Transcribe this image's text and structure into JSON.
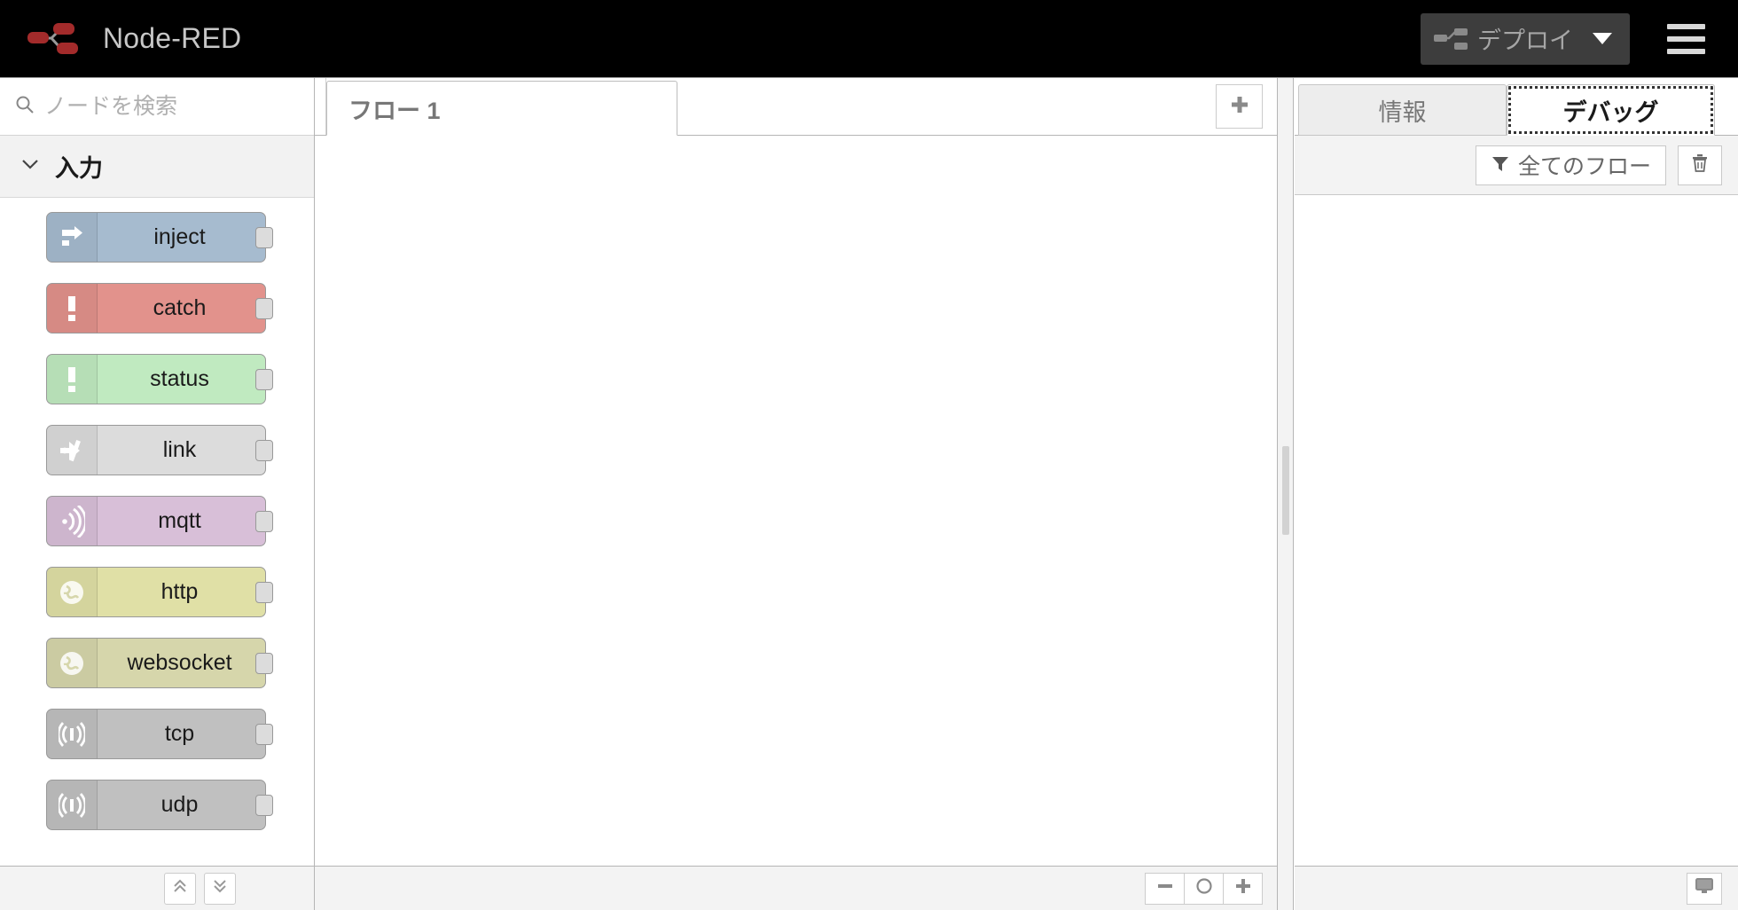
{
  "header": {
    "brand_title": "Node-RED",
    "brand_logo_icon": "node-red-logo-icon",
    "deploy": {
      "label": "デプロイ",
      "icon": "deploy-node-icon",
      "caret_icon": "chevron-down-icon",
      "disabled": true,
      "background": "#3d3d3d",
      "text_color": "#a6a6a6"
    },
    "menu_icon": "hamburger-menu-icon",
    "background": "#000000"
  },
  "palette": {
    "search": {
      "placeholder": "ノードを検索",
      "value": "",
      "icon": "search-icon"
    },
    "categories": [
      {
        "label": "入力",
        "chevron_icon": "chevron-down-icon",
        "expanded": true,
        "nodes": [
          {
            "label": "inject",
            "icon": "inject-arrow-icon",
            "color": "#a6bbcf"
          },
          {
            "label": "catch",
            "icon": "exclamation-icon",
            "color": "#e2928c"
          },
          {
            "label": "status",
            "icon": "exclamation-icon",
            "color": "#c0eac0"
          },
          {
            "label": "link",
            "icon": "link-arrow-icon",
            "color": "#dcdcdc"
          },
          {
            "label": "mqtt",
            "icon": "signal-wave-icon",
            "color": "#d8bfd8"
          },
          {
            "label": "http",
            "icon": "globe-icon",
            "color": "#e0e0a6"
          },
          {
            "label": "websocket",
            "icon": "globe-icon",
            "color": "#d6d6ab"
          },
          {
            "label": "tcp",
            "icon": "bidirectional-signal-icon",
            "color": "#c0c0c0"
          },
          {
            "label": "udp",
            "icon": "bidirectional-signal-icon",
            "color": "#c0c0c0"
          }
        ]
      }
    ],
    "footer": {
      "collapse_all_label": "collapse-all",
      "collapse_all_icon": "double-chevron-up-icon",
      "expand_all_label": "expand-all",
      "expand_all_icon": "double-chevron-down-icon"
    }
  },
  "workspace": {
    "tabs": [
      {
        "label": "フロー 1",
        "active": true
      }
    ],
    "add_tab_icon": "plus-icon",
    "canvas_empty": true,
    "zoom_controls": {
      "zoom_out_icon": "minus-icon",
      "zoom_reset_icon": "circle-icon",
      "zoom_in_icon": "plus-icon"
    }
  },
  "sidebar": {
    "tabs": [
      {
        "label": "情報",
        "active": false
      },
      {
        "label": "デバッグ",
        "active": true
      }
    ],
    "debug": {
      "filter_label": "全てのフロー",
      "filter_icon": "funnel-icon",
      "clear_icon": "trash-icon",
      "messages": []
    },
    "footer": {
      "icon": "monitor-icon"
    }
  }
}
